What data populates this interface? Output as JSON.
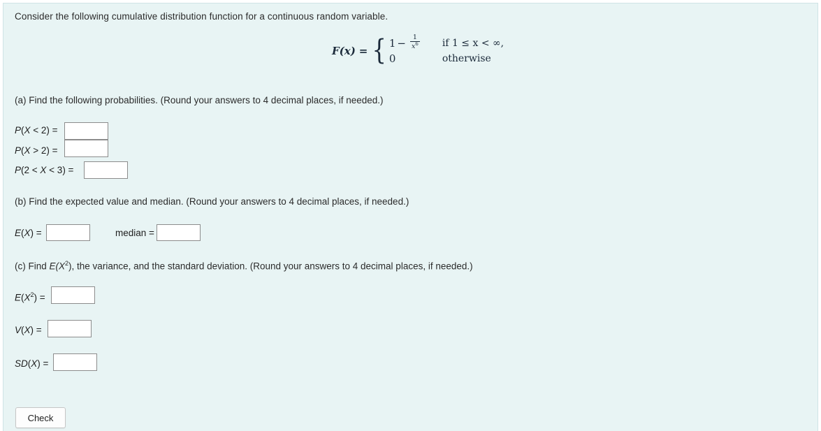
{
  "prompt": "Consider the following cumulative distribution function for a continuous random variable.",
  "formula": {
    "lhs": "F(x)",
    "equals": "=",
    "case1_expr_lead": "1",
    "case1_minus": "−",
    "case1_frac_num": "1",
    "case1_frac_den_base": "x",
    "case1_frac_den_exp": "6",
    "case1_condition": "if 1 ≤ x < ∞,",
    "case2_expr": "0",
    "case2_condition": "otherwise"
  },
  "sections": {
    "a": {
      "heading": "(a) Find the following probabilities. (Round your answers to 4 decimal places, if needed.)",
      "rows": [
        {
          "label": "P(X < 2) =",
          "value": ""
        },
        {
          "label": "P(X > 2) =",
          "value": ""
        },
        {
          "label": "P(2 < X < 3) =",
          "value": ""
        }
      ]
    },
    "b": {
      "heading": "(b) Find the expected value and median. (Round your answers to 4 decimal places, if needed.)",
      "ex_label": "E(X) =",
      "ex_value": "",
      "median_label": "median =",
      "median_value": ""
    },
    "c": {
      "heading_pre": "(c) Find ",
      "heading_ex2": "E(X",
      "heading_ex2_sup": "2",
      "heading_post": "), the variance, and the standard deviation. (Round your answers to 4 decimal places, if needed.)",
      "rows": [
        {
          "label_base": "E(X",
          "label_sup": "2",
          "label_tail": ") =",
          "value": ""
        },
        {
          "label_base": "V(X",
          "label_sup": "",
          "label_tail": ") =",
          "value": ""
        },
        {
          "label_base": "SD(X",
          "label_sup": "",
          "label_tail": ") =",
          "value": ""
        }
      ]
    }
  },
  "check_button": {
    "label": "Check"
  },
  "colors": {
    "page_background": "#e8f4f4",
    "input_border": "#8c8c8c",
    "text": "#2b2b2b",
    "formula_text": "#1b2a3a"
  }
}
